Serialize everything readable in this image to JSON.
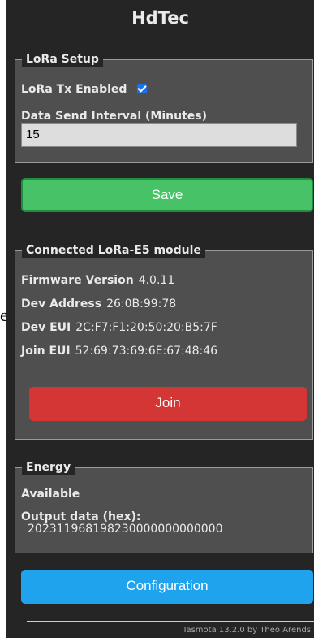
{
  "stray_text": "e",
  "title": "HdTec",
  "lora_setup": {
    "legend": "LoRa Setup",
    "tx_enabled_label": "LoRa Tx Enabled",
    "tx_enabled_checked": true,
    "interval_label": "Data Send Interval (Minutes)",
    "interval_value": "15"
  },
  "save_label": "Save",
  "module": {
    "legend": "Connected LoRa-E5 module",
    "firmware_label": "Firmware Version",
    "firmware_value": "4.0.11",
    "dev_address_label": "Dev Address",
    "dev_address_value": "26:0B:99:78",
    "dev_eui_label": "Dev EUI",
    "dev_eui_value": "2C:F7:F1:20:50:20:B5:7F",
    "join_eui_label": "Join EUI",
    "join_eui_value": "52:69:73:69:6E:67:48:46",
    "join_label": "Join"
  },
  "energy": {
    "legend": "Energy",
    "status": "Available",
    "output_label": "Output data (hex):",
    "output_value": "202311968198230000000000000"
  },
  "config_label": "Configuration",
  "footer": "Tasmota 13.2.0 by Theo Arends",
  "colors": {
    "panel_bg": "#252525",
    "fieldset_bg": "#4f4f4f",
    "save_green": "#47c266",
    "join_red": "#d43535",
    "config_blue": "#1fa3ec",
    "checkbox_blue": "#1a73e8"
  }
}
